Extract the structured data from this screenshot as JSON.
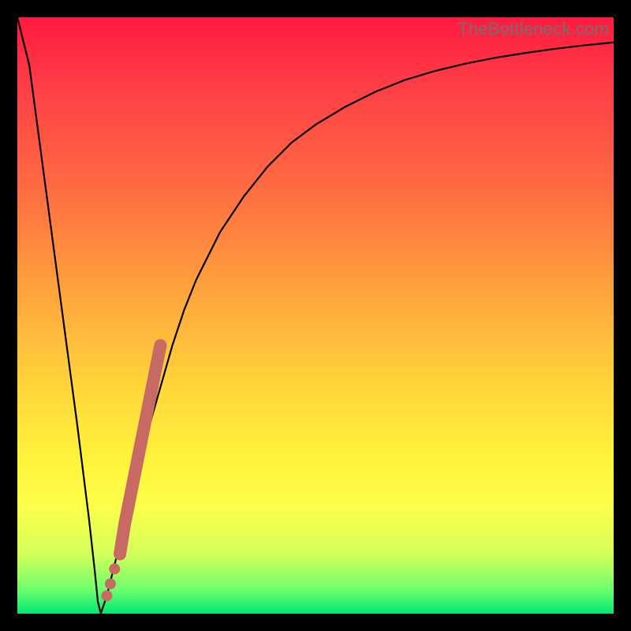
{
  "watermark": "TheBottleneck.com",
  "chart_data": {
    "type": "line",
    "title": "",
    "xlabel": "",
    "ylabel": "",
    "xlim": [
      0,
      100
    ],
    "ylim": [
      0,
      100
    ],
    "series": [
      {
        "name": "bottleneck-curve",
        "x": [
          0,
          2,
          4,
          6,
          8,
          10,
          12,
          13,
          13.5,
          14,
          15,
          16,
          18,
          20,
          22,
          24,
          26,
          28,
          30,
          34,
          38,
          42,
          46,
          50,
          55,
          60,
          65,
          70,
          75,
          80,
          85,
          90,
          95,
          100
        ],
        "values": [
          100,
          92,
          77,
          62,
          47,
          32,
          16,
          7,
          2,
          0,
          3,
          7,
          15,
          23,
          31,
          38,
          45,
          51,
          56,
          64,
          70,
          75,
          79,
          82,
          85,
          87.5,
          89.5,
          91,
          92.2,
          93.2,
          94,
          94.7,
          95.3,
          95.8
        ]
      }
    ],
    "highlight_segment": {
      "name": "emphasis-band",
      "color": "#c86a64",
      "x": [
        17.2,
        18,
        19,
        20,
        21,
        22,
        23,
        24
      ],
      "values": [
        10,
        15,
        20,
        25,
        30,
        35,
        40,
        45
      ]
    },
    "highlight_dots": {
      "name": "emphasis-dots",
      "color": "#c86a64",
      "points": [
        {
          "x": 15.0,
          "y": 3.0
        },
        {
          "x": 15.6,
          "y": 5.0
        },
        {
          "x": 16.3,
          "y": 7.5
        }
      ]
    },
    "background_gradient": {
      "top": "#ff1a3f",
      "mid1": "#ffa33c",
      "mid2": "#fff33a",
      "bottom": "#00e676"
    }
  }
}
